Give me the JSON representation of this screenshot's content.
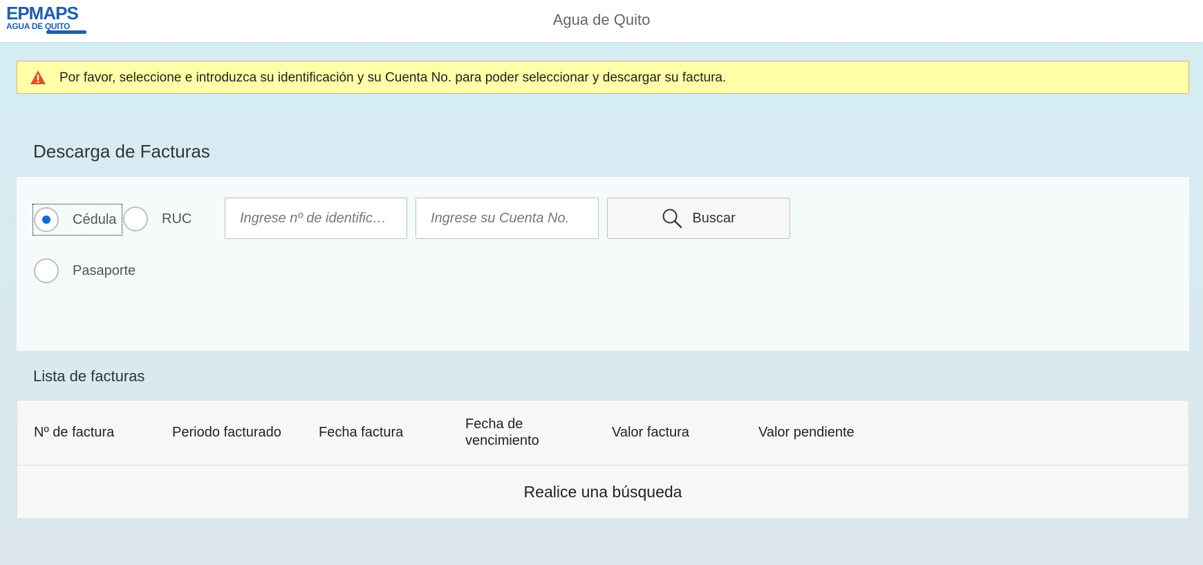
{
  "header": {
    "logo_main": "EPMAPS",
    "logo_sub": "AGUA DE QUITO",
    "title": "Agua de Quito"
  },
  "message": {
    "text": "Por favor, seleccione e introduzca su identificación y su Cuenta No. para poder seleccionar y descargar su factura.",
    "icon": "warning-icon"
  },
  "form": {
    "title": "Descarga de Facturas",
    "id_types": [
      {
        "label": "Cédula",
        "checked": true
      },
      {
        "label": "RUC",
        "checked": false
      },
      {
        "label": "Pasaporte",
        "checked": false
      }
    ],
    "id_input_placeholder": "Ingrese nº de identificación",
    "account_input_placeholder": "Ingrese su Cuenta No.",
    "search_label": "Buscar",
    "search_icon": "search-icon"
  },
  "invoices": {
    "title": "Lista de facturas",
    "columns": [
      "Nº de factura",
      "Periodo facturado",
      "Fecha factura",
      "Fecha de vencimiento",
      "Valor factura",
      "Valor pendiente"
    ],
    "empty_text": "Realice una búsqueda"
  },
  "colors": {
    "brand": "#1b5fae",
    "accent": "#0a6ed1",
    "warning_bg": "#ffffa8",
    "warning_icon": "#e9511f"
  }
}
